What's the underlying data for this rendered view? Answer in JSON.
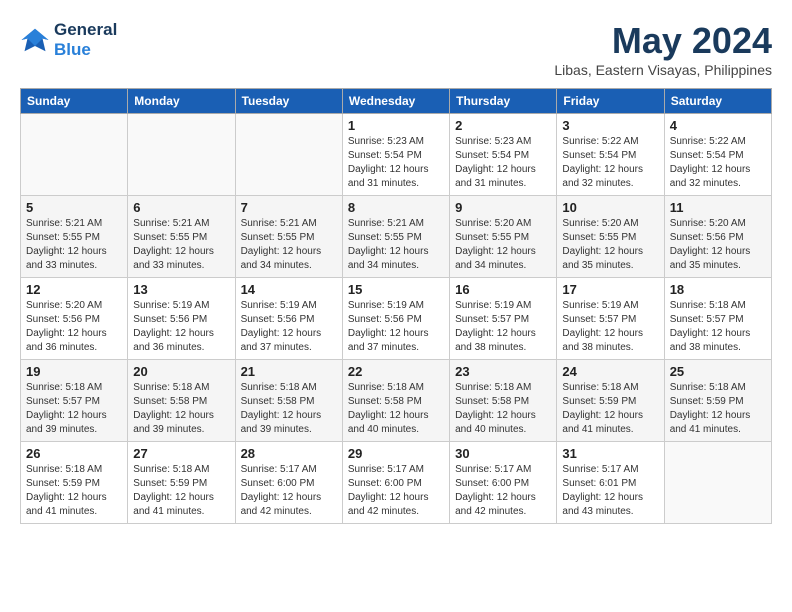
{
  "header": {
    "logo_line1": "General",
    "logo_line2": "Blue",
    "month_title": "May 2024",
    "location": "Libas, Eastern Visayas, Philippines"
  },
  "weekdays": [
    "Sunday",
    "Monday",
    "Tuesday",
    "Wednesday",
    "Thursday",
    "Friday",
    "Saturday"
  ],
  "weeks": [
    [
      {
        "day": "",
        "info": ""
      },
      {
        "day": "",
        "info": ""
      },
      {
        "day": "",
        "info": ""
      },
      {
        "day": "1",
        "info": "Sunrise: 5:23 AM\nSunset: 5:54 PM\nDaylight: 12 hours\nand 31 minutes."
      },
      {
        "day": "2",
        "info": "Sunrise: 5:23 AM\nSunset: 5:54 PM\nDaylight: 12 hours\nand 31 minutes."
      },
      {
        "day": "3",
        "info": "Sunrise: 5:22 AM\nSunset: 5:54 PM\nDaylight: 12 hours\nand 32 minutes."
      },
      {
        "day": "4",
        "info": "Sunrise: 5:22 AM\nSunset: 5:54 PM\nDaylight: 12 hours\nand 32 minutes."
      }
    ],
    [
      {
        "day": "5",
        "info": "Sunrise: 5:21 AM\nSunset: 5:55 PM\nDaylight: 12 hours\nand 33 minutes."
      },
      {
        "day": "6",
        "info": "Sunrise: 5:21 AM\nSunset: 5:55 PM\nDaylight: 12 hours\nand 33 minutes."
      },
      {
        "day": "7",
        "info": "Sunrise: 5:21 AM\nSunset: 5:55 PM\nDaylight: 12 hours\nand 34 minutes."
      },
      {
        "day": "8",
        "info": "Sunrise: 5:21 AM\nSunset: 5:55 PM\nDaylight: 12 hours\nand 34 minutes."
      },
      {
        "day": "9",
        "info": "Sunrise: 5:20 AM\nSunset: 5:55 PM\nDaylight: 12 hours\nand 34 minutes."
      },
      {
        "day": "10",
        "info": "Sunrise: 5:20 AM\nSunset: 5:55 PM\nDaylight: 12 hours\nand 35 minutes."
      },
      {
        "day": "11",
        "info": "Sunrise: 5:20 AM\nSunset: 5:56 PM\nDaylight: 12 hours\nand 35 minutes."
      }
    ],
    [
      {
        "day": "12",
        "info": "Sunrise: 5:20 AM\nSunset: 5:56 PM\nDaylight: 12 hours\nand 36 minutes."
      },
      {
        "day": "13",
        "info": "Sunrise: 5:19 AM\nSunset: 5:56 PM\nDaylight: 12 hours\nand 36 minutes."
      },
      {
        "day": "14",
        "info": "Sunrise: 5:19 AM\nSunset: 5:56 PM\nDaylight: 12 hours\nand 37 minutes."
      },
      {
        "day": "15",
        "info": "Sunrise: 5:19 AM\nSunset: 5:56 PM\nDaylight: 12 hours\nand 37 minutes."
      },
      {
        "day": "16",
        "info": "Sunrise: 5:19 AM\nSunset: 5:57 PM\nDaylight: 12 hours\nand 38 minutes."
      },
      {
        "day": "17",
        "info": "Sunrise: 5:19 AM\nSunset: 5:57 PM\nDaylight: 12 hours\nand 38 minutes."
      },
      {
        "day": "18",
        "info": "Sunrise: 5:18 AM\nSunset: 5:57 PM\nDaylight: 12 hours\nand 38 minutes."
      }
    ],
    [
      {
        "day": "19",
        "info": "Sunrise: 5:18 AM\nSunset: 5:57 PM\nDaylight: 12 hours\nand 39 minutes."
      },
      {
        "day": "20",
        "info": "Sunrise: 5:18 AM\nSunset: 5:58 PM\nDaylight: 12 hours\nand 39 minutes."
      },
      {
        "day": "21",
        "info": "Sunrise: 5:18 AM\nSunset: 5:58 PM\nDaylight: 12 hours\nand 39 minutes."
      },
      {
        "day": "22",
        "info": "Sunrise: 5:18 AM\nSunset: 5:58 PM\nDaylight: 12 hours\nand 40 minutes."
      },
      {
        "day": "23",
        "info": "Sunrise: 5:18 AM\nSunset: 5:58 PM\nDaylight: 12 hours\nand 40 minutes."
      },
      {
        "day": "24",
        "info": "Sunrise: 5:18 AM\nSunset: 5:59 PM\nDaylight: 12 hours\nand 41 minutes."
      },
      {
        "day": "25",
        "info": "Sunrise: 5:18 AM\nSunset: 5:59 PM\nDaylight: 12 hours\nand 41 minutes."
      }
    ],
    [
      {
        "day": "26",
        "info": "Sunrise: 5:18 AM\nSunset: 5:59 PM\nDaylight: 12 hours\nand 41 minutes."
      },
      {
        "day": "27",
        "info": "Sunrise: 5:18 AM\nSunset: 5:59 PM\nDaylight: 12 hours\nand 41 minutes."
      },
      {
        "day": "28",
        "info": "Sunrise: 5:17 AM\nSunset: 6:00 PM\nDaylight: 12 hours\nand 42 minutes."
      },
      {
        "day": "29",
        "info": "Sunrise: 5:17 AM\nSunset: 6:00 PM\nDaylight: 12 hours\nand 42 minutes."
      },
      {
        "day": "30",
        "info": "Sunrise: 5:17 AM\nSunset: 6:00 PM\nDaylight: 12 hours\nand 42 minutes."
      },
      {
        "day": "31",
        "info": "Sunrise: 5:17 AM\nSunset: 6:01 PM\nDaylight: 12 hours\nand 43 minutes."
      },
      {
        "day": "",
        "info": ""
      }
    ]
  ]
}
